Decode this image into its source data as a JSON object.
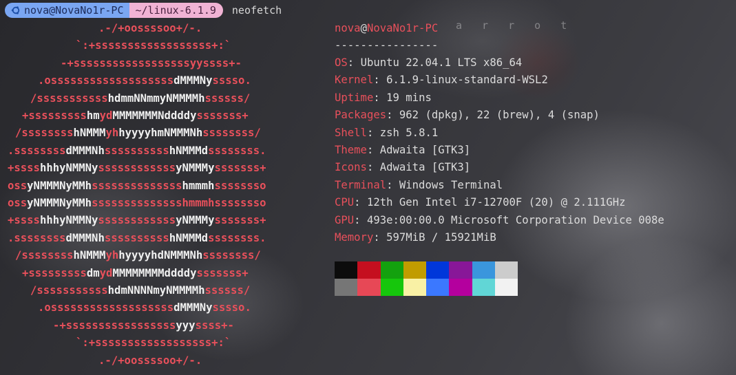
{
  "prompt": {
    "user_host": "nova@NovaNo1r-PC",
    "directory": "~/linux-6.1.9",
    "command": "neofetch"
  },
  "ghost_text": "a r r o t",
  "logo": [
    {
      "l": 143,
      "segs": [
        {
          "c": "r",
          "t": ".-/+oossssoo+/-."
        }
      ]
    },
    {
      "l": 110,
      "segs": [
        {
          "c": "r",
          "t": "`:+ssssssssssssssssss+:`"
        }
      ]
    },
    {
      "l": 88,
      "segs": [
        {
          "c": "r",
          "t": "-+ssssssssssssssssssyyssss+-"
        }
      ]
    },
    {
      "l": 55,
      "segs": [
        {
          "c": "r",
          "t": ".osssssssssssssssssss"
        },
        {
          "c": "w",
          "t": "dMMMNy"
        },
        {
          "c": "r",
          "t": "sssso."
        }
      ]
    },
    {
      "l": 44,
      "segs": [
        {
          "c": "r",
          "t": "/sssssssssss"
        },
        {
          "c": "w",
          "t": "hdmmNNmmyNMMMMh"
        },
        {
          "c": "r",
          "t": "ssssss/"
        }
      ]
    },
    {
      "l": 32,
      "segs": [
        {
          "c": "r",
          "t": "+sssssssss"
        },
        {
          "c": "w",
          "t": "hm"
        },
        {
          "c": "r",
          "t": "yd"
        },
        {
          "c": "w",
          "t": "MMMMMMMNddddy"
        },
        {
          "c": "r",
          "t": "sssssss+"
        }
      ]
    },
    {
      "l": 22,
      "segs": [
        {
          "c": "r",
          "t": "/ssssssss"
        },
        {
          "c": "w",
          "t": "hNMMM"
        },
        {
          "c": "r",
          "t": "yh"
        },
        {
          "c": "w",
          "t": "hyyyyhmNMMMNh"
        },
        {
          "c": "r",
          "t": "ssssssss/"
        }
      ]
    },
    {
      "l": 11,
      "segs": [
        {
          "c": "r",
          "t": ".ssssssss"
        },
        {
          "c": "w",
          "t": "dMMMNh"
        },
        {
          "c": "r",
          "t": "ssssssssss"
        },
        {
          "c": "w",
          "t": "hNMMMd"
        },
        {
          "c": "r",
          "t": "ssssssss."
        }
      ]
    },
    {
      "l": 11,
      "segs": [
        {
          "c": "r",
          "t": "+ssss"
        },
        {
          "c": "w",
          "t": "hhhyNMMNy"
        },
        {
          "c": "r",
          "t": "ssssssssssss"
        },
        {
          "c": "w",
          "t": "yNMMMy"
        },
        {
          "c": "r",
          "t": "sssssss+"
        }
      ]
    },
    {
      "l": 11,
      "segs": [
        {
          "c": "r",
          "t": "oss"
        },
        {
          "c": "w",
          "t": "yNMMMNyMMh"
        },
        {
          "c": "r",
          "t": "ssssssssssssss"
        },
        {
          "c": "w",
          "t": "hmmmh"
        },
        {
          "c": "r",
          "t": "ssssssso"
        }
      ]
    },
    {
      "l": 11,
      "segs": [
        {
          "c": "r",
          "t": "oss"
        },
        {
          "c": "w",
          "t": "yNMMMNyMMh"
        },
        {
          "c": "r",
          "t": "sssssssssssssshmmmhssssssso"
        }
      ]
    },
    {
      "l": 11,
      "segs": [
        {
          "c": "r",
          "t": "+ssss"
        },
        {
          "c": "w",
          "t": "hhhyNMMNy"
        },
        {
          "c": "r",
          "t": "ssssssssssss"
        },
        {
          "c": "w",
          "t": "yNMMMy"
        },
        {
          "c": "r",
          "t": "sssssss+"
        }
      ]
    },
    {
      "l": 11,
      "segs": [
        {
          "c": "r",
          "t": ".ssssssss"
        },
        {
          "c": "w",
          "t": "dMMMNh"
        },
        {
          "c": "r",
          "t": "ssssssssss"
        },
        {
          "c": "w",
          "t": "hNMMMd"
        },
        {
          "c": "r",
          "t": "ssssssss."
        }
      ]
    },
    {
      "l": 22,
      "segs": [
        {
          "c": "r",
          "t": "/ssssssss"
        },
        {
          "c": "w",
          "t": "hNMMM"
        },
        {
          "c": "r",
          "t": "yh"
        },
        {
          "c": "w",
          "t": "hyyyyhdNMMMNh"
        },
        {
          "c": "r",
          "t": "ssssssss/"
        }
      ]
    },
    {
      "l": 32,
      "segs": [
        {
          "c": "r",
          "t": "+sssssssss"
        },
        {
          "c": "w",
          "t": "dm"
        },
        {
          "c": "r",
          "t": "yd"
        },
        {
          "c": "w",
          "t": "MMMMMMMMddddy"
        },
        {
          "c": "r",
          "t": "sssssss+"
        }
      ]
    },
    {
      "l": 44,
      "segs": [
        {
          "c": "r",
          "t": "/sssssssssss"
        },
        {
          "c": "w",
          "t": "hdmNNNNmyNMMMMh"
        },
        {
          "c": "r",
          "t": "ssssss/"
        }
      ]
    },
    {
      "l": 55,
      "segs": [
        {
          "c": "r",
          "t": ".osssssssssssssssssss"
        },
        {
          "c": "w",
          "t": "dMMMNy"
        },
        {
          "c": "r",
          "t": "sssso."
        }
      ]
    },
    {
      "l": 77,
      "segs": [
        {
          "c": "r",
          "t": "-+sssssssssssssssss"
        },
        {
          "c": "w",
          "t": "yyy"
        },
        {
          "c": "r",
          "t": "ssss+-"
        }
      ]
    },
    {
      "l": 110,
      "segs": [
        {
          "c": "r",
          "t": "`:+ssssssssssssssssss+:`"
        }
      ]
    },
    {
      "l": 143,
      "segs": [
        {
          "c": "r",
          "t": ".-/+oossssoo+/-."
        }
      ]
    }
  ],
  "info": {
    "user": "nova",
    "at": "@",
    "host": "NovaNo1r-PC",
    "divider": "----------------",
    "fields": [
      {
        "key": "OS",
        "value": "Ubuntu 22.04.1 LTS x86_64"
      },
      {
        "key": "Kernel",
        "value": "6.1.9-linux-standard-WSL2"
      },
      {
        "key": "Uptime",
        "value": "19 mins"
      },
      {
        "key": "Packages",
        "value": "962 (dpkg), 22 (brew), 4 (snap)"
      },
      {
        "key": "Shell",
        "value": "zsh 5.8.1"
      },
      {
        "key": "Theme",
        "value": "Adwaita [GTK3]"
      },
      {
        "key": "Icons",
        "value": "Adwaita [GTK3]"
      },
      {
        "key": "Terminal",
        "value": "Windows Terminal"
      },
      {
        "key": "CPU",
        "value": "12th Gen Intel i7-12700F (20) @ 2.111GHz"
      },
      {
        "key": "GPU",
        "value": "493e:00:00.0 Microsoft Corporation Device 008e"
      },
      {
        "key": "Memory",
        "value": "597MiB / 15921MiB"
      }
    ],
    "separator": ": "
  },
  "palette": {
    "row1": [
      "#0c0c0c",
      "#c50f1f",
      "#13a10e",
      "#c19c00",
      "#0037da",
      "#881798",
      "#3a96dd",
      "#cccccc"
    ],
    "row2": [
      "#767676",
      "#e74856",
      "#16c60c",
      "#f9f1a5",
      "#3b78ff",
      "#b4009e",
      "#61d6d6",
      "#f2f2f2"
    ]
  }
}
